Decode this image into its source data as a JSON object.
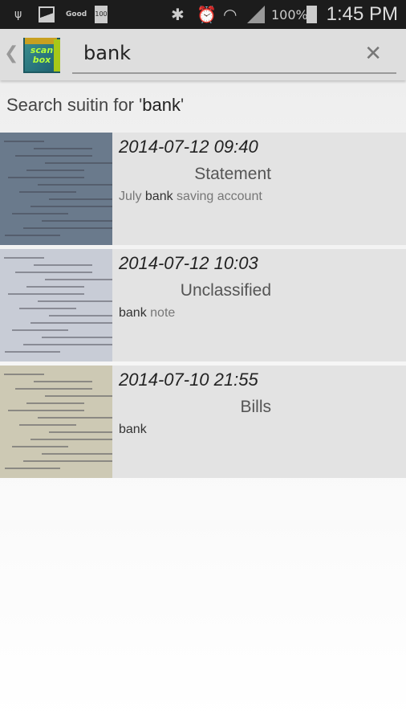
{
  "status_bar": {
    "icons": [
      "usb-icon",
      "image-icon",
      "good-badge-icon",
      "battery-100-icon",
      "bluetooth-icon",
      "alarm-icon",
      "wifi-icon",
      "signal-icon"
    ],
    "good_label": "Good",
    "battery_small": "100",
    "battery": "100%",
    "time": "1:45 PM"
  },
  "action_bar": {
    "app_name": "scan box",
    "logo_line1": "scan",
    "logo_line2": "box",
    "search_value": "bank",
    "clear_icon": "close-icon"
  },
  "heading": {
    "prefix": "Search suitin for '",
    "term": "bank",
    "suffix": "'"
  },
  "results": [
    {
      "date": "2014-07-12 09:40",
      "category": "Statement",
      "note_pre": "July ",
      "note_match": "bank",
      "note_post": " saving account",
      "thumb_color": "#6a7a8c"
    },
    {
      "date": "2014-07-12 10:03",
      "category": "Unclassified",
      "note_pre": "",
      "note_match": "bank",
      "note_post": " note",
      "thumb_color": "#c8ccd6"
    },
    {
      "date": "2014-07-10 21:55",
      "category": "Bills",
      "note_pre": "",
      "note_match": "bank",
      "note_post": "",
      "thumb_color": "#cdc9b4"
    }
  ]
}
